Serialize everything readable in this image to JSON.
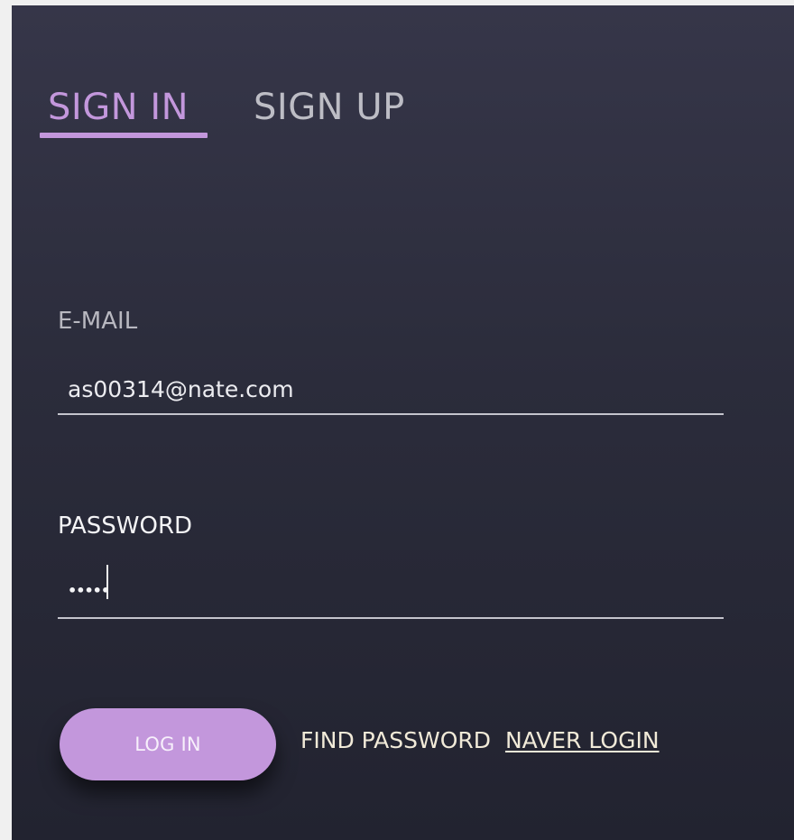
{
  "tabs": {
    "sign_in": "SIGN IN",
    "sign_up": "SIGN UP",
    "active": "sign_in"
  },
  "email": {
    "label": "E-MAIL",
    "value": "as00314@nate.com"
  },
  "password": {
    "label": "PASSWORD",
    "masked_value": "•••••"
  },
  "actions": {
    "login_label": "LOG IN",
    "find_password_label": "FIND PASSWORD",
    "naver_login_label": "NAVER LOGIN"
  },
  "colors": {
    "accent": "#c397dc",
    "panel_top": "#363649",
    "panel_bottom": "#222330",
    "page_background": "#f0f0f0",
    "link_text": "#f1ead8"
  }
}
